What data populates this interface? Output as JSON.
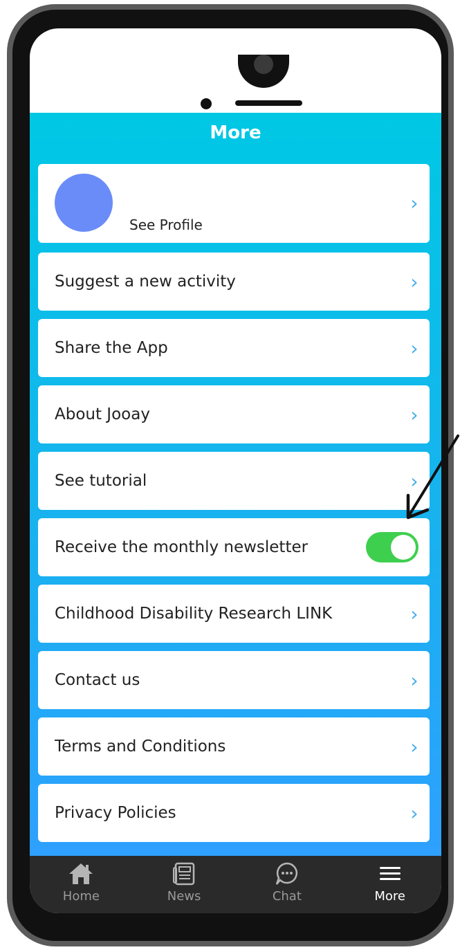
{
  "header": {
    "title": "More"
  },
  "profile": {
    "label": "See Profile",
    "avatar_color": "#6a8cf8"
  },
  "menu_items": [
    {
      "label": "Suggest a new activity"
    },
    {
      "label": "Share the App"
    },
    {
      "label": "About Jooay"
    },
    {
      "label": "See tutorial"
    },
    {
      "label": "Receive the monthly newsletter",
      "toggle": true,
      "toggle_on": true
    },
    {
      "label": "Childhood Disability Research LINK"
    },
    {
      "label": "Contact us"
    },
    {
      "label": "Terms and Conditions"
    },
    {
      "label": "Privacy Policies"
    }
  ],
  "tabs": [
    {
      "label": "Home",
      "icon": "home-icon"
    },
    {
      "label": "News",
      "icon": "newspaper-icon"
    },
    {
      "label": "Chat",
      "icon": "chat-bubble-icon"
    },
    {
      "label": "More",
      "icon": "menu-icon",
      "active": true
    }
  ],
  "colors": {
    "header_gradient_top": "#00c8e4",
    "header_gradient_bottom": "#2ea0ff",
    "toggle_on": "#3fcf4f",
    "chevron": "#47aee8",
    "tabbar": "#2a2a2a"
  }
}
